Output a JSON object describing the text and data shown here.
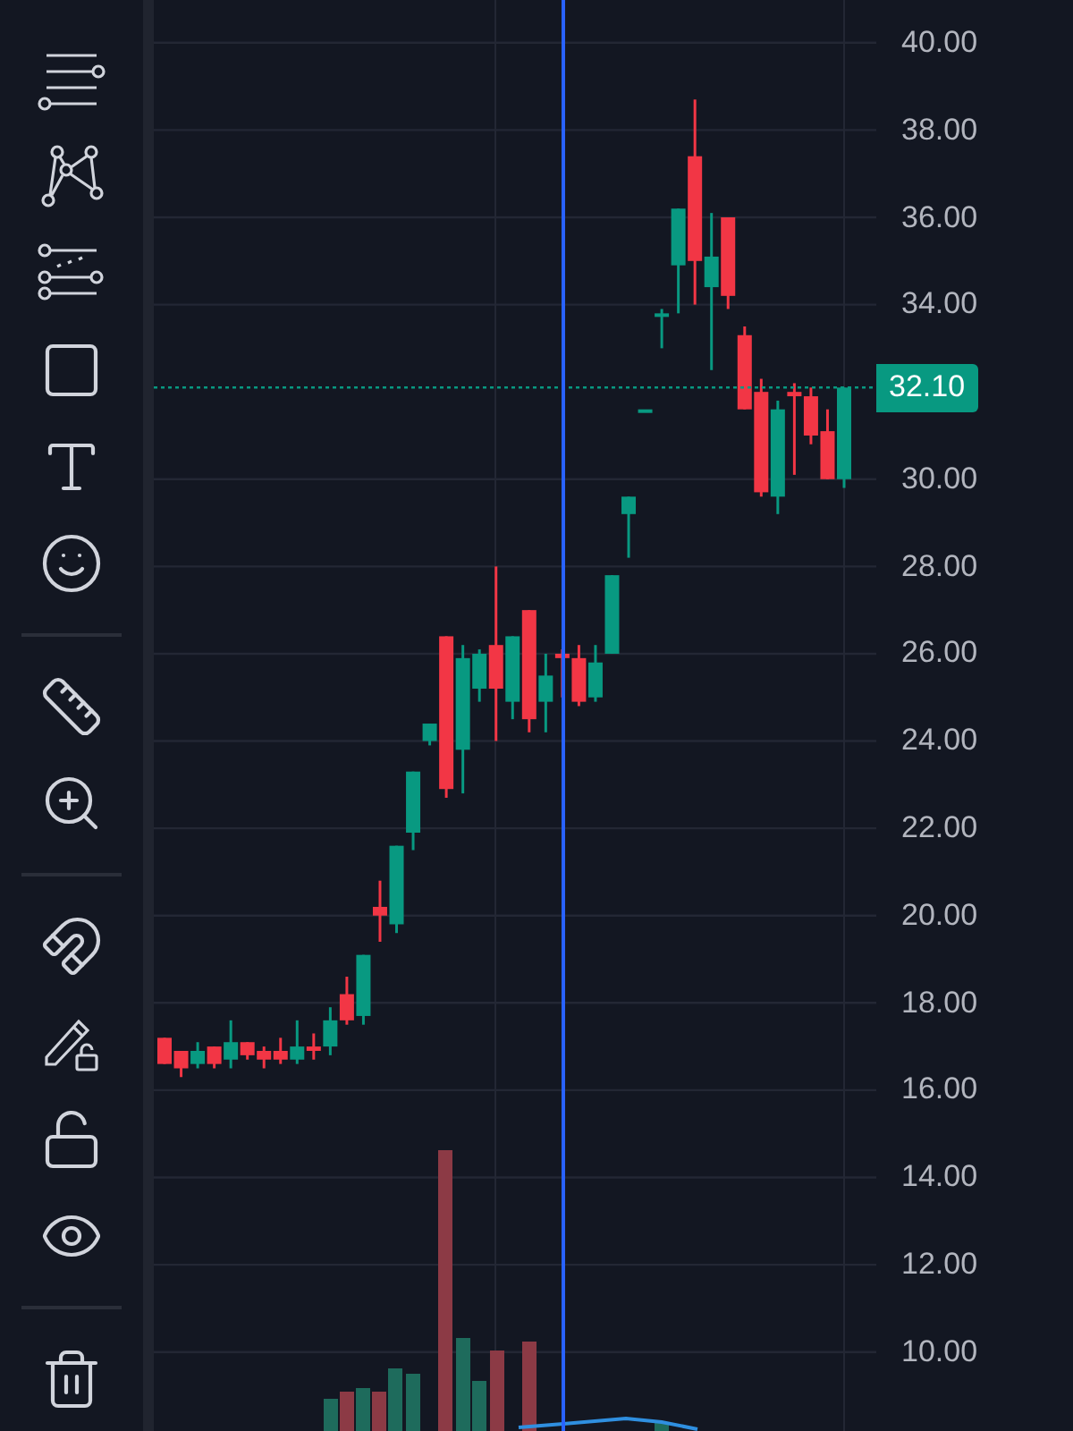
{
  "toolbar": [
    {
      "kind": "lines"
    },
    {
      "kind": "pattern"
    },
    {
      "kind": "fib"
    },
    {
      "kind": "rectangle"
    },
    {
      "kind": "text"
    },
    {
      "kind": "emoji"
    },
    {
      "kind": "divider"
    },
    {
      "kind": "ruler"
    },
    {
      "kind": "zoom"
    },
    {
      "kind": "divider"
    },
    {
      "kind": "magnet"
    },
    {
      "kind": "drawlock"
    },
    {
      "kind": "lock"
    },
    {
      "kind": "eye"
    },
    {
      "kind": "divider"
    },
    {
      "kind": "trash"
    }
  ],
  "chart": {
    "chart_data": {
      "type": "candlestick",
      "ohlc": [
        [
          17.2,
          17.2,
          16.6,
          16.6
        ],
        [
          16.9,
          16.9,
          16.3,
          16.5
        ],
        [
          16.6,
          17.1,
          16.5,
          16.9
        ],
        [
          17.0,
          17.0,
          16.5,
          16.6
        ],
        [
          16.7,
          17.6,
          16.5,
          17.1
        ],
        [
          17.1,
          17.1,
          16.7,
          16.8
        ],
        [
          16.9,
          17.0,
          16.5,
          16.7
        ],
        [
          16.9,
          17.2,
          16.6,
          16.7
        ],
        [
          16.7,
          17.6,
          16.6,
          17.0
        ],
        [
          17.0,
          17.3,
          16.7,
          16.9
        ],
        [
          17.0,
          17.9,
          16.8,
          17.6
        ],
        [
          18.2,
          18.6,
          17.5,
          17.6
        ],
        [
          17.7,
          19.1,
          17.5,
          19.1
        ],
        [
          20.2,
          20.8,
          19.4,
          20.0
        ],
        [
          19.8,
          21.6,
          19.6,
          21.6
        ],
        [
          21.9,
          23.3,
          21.5,
          23.3
        ],
        [
          24.0,
          24.4,
          23.9,
          24.4
        ],
        [
          26.4,
          26.4,
          22.7,
          22.9
        ],
        [
          23.8,
          26.2,
          22.8,
          25.9
        ],
        [
          25.2,
          26.1,
          24.9,
          26.0
        ],
        [
          26.2,
          28.0,
          24.0,
          25.2
        ],
        [
          24.9,
          26.4,
          24.5,
          26.4
        ],
        [
          27.0,
          27.0,
          24.2,
          24.5
        ],
        [
          24.9,
          26.0,
          24.2,
          25.5
        ],
        [
          26.0,
          26.1,
          25.0,
          25.9
        ],
        [
          25.9,
          26.2,
          24.8,
          24.9
        ],
        [
          25.0,
          26.2,
          24.9,
          25.8
        ],
        [
          26.0,
          27.8,
          26.0,
          27.8
        ],
        [
          29.2,
          29.6,
          28.2,
          29.6
        ],
        [
          31.6,
          31.6,
          31.6,
          31.6
        ],
        [
          33.8,
          33.9,
          33.0,
          33.8
        ],
        [
          34.9,
          36.2,
          33.8,
          36.2
        ],
        [
          37.4,
          38.7,
          34.0,
          35.0
        ],
        [
          34.4,
          36.1,
          32.5,
          35.1
        ],
        [
          36.0,
          36.0,
          33.9,
          34.2
        ],
        [
          33.3,
          33.5,
          31.6,
          31.6
        ],
        [
          32.0,
          32.3,
          29.6,
          29.7
        ],
        [
          29.6,
          31.8,
          29.2,
          31.6
        ],
        [
          32.0,
          32.2,
          30.1,
          31.9
        ],
        [
          31.9,
          32.1,
          30.8,
          31.0
        ],
        [
          31.1,
          31.6,
          30.0,
          30.0
        ],
        [
          30.0,
          32.1,
          29.8,
          32.1
        ]
      ],
      "grid": true,
      "ref_lines": [
        {
          "axis": "y",
          "value": 32.1,
          "label": "32.10"
        }
      ],
      "ylim": [
        8.19,
        40.98
      ],
      "yticks": [
        {
          "value": 40,
          "label": "40.00"
        },
        {
          "value": 38,
          "label": "38.00"
        },
        {
          "value": 36,
          "label": "36.00"
        },
        {
          "value": 34,
          "label": "34.00"
        },
        {
          "value": 30,
          "label": "30.00"
        },
        {
          "value": 28,
          "label": "28.00"
        },
        {
          "value": 26,
          "label": "26.00"
        },
        {
          "value": 24,
          "label": "24.00"
        },
        {
          "value": 22,
          "label": "22.00"
        },
        {
          "value": 20,
          "label": "20.00"
        },
        {
          "value": 18,
          "label": "18.00"
        },
        {
          "value": 16,
          "label": "16.00"
        },
        {
          "value": 14,
          "label": "14.00"
        },
        {
          "value": 12,
          "label": "12.00"
        },
        {
          "value": 10,
          "label": "10.00"
        }
      ]
    }
  }
}
